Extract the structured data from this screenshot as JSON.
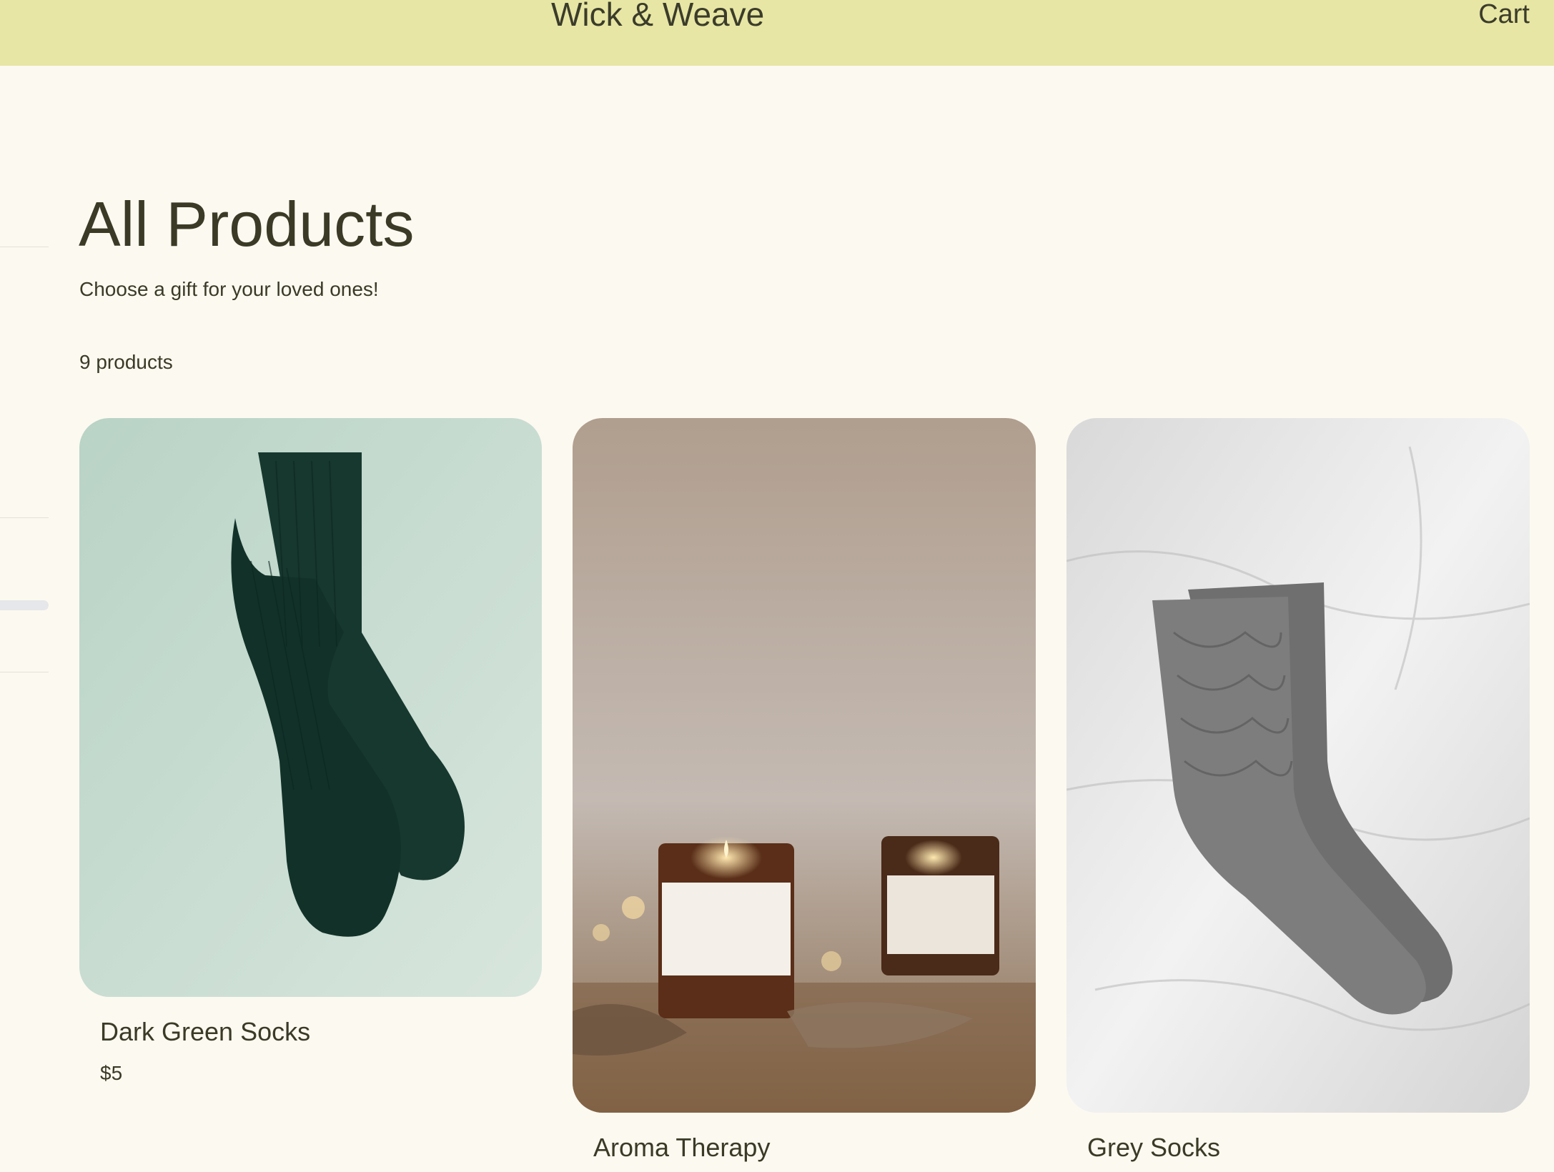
{
  "header": {
    "brand": "Wick & Weave",
    "cart_label": "Cart"
  },
  "collection": {
    "title": "All Products",
    "subtitle": "Choose a gift for your loved ones!",
    "count": "9 products"
  },
  "products": [
    {
      "name": "Dark Green Socks",
      "price": "$5"
    },
    {
      "name": "Aroma Therapy",
      "price": ""
    },
    {
      "name": "Grey Socks",
      "price": ""
    }
  ],
  "colors": {
    "header_bg": "#e7e6a4",
    "page_bg": "#fcf9f0",
    "text": "#3a3a26"
  }
}
